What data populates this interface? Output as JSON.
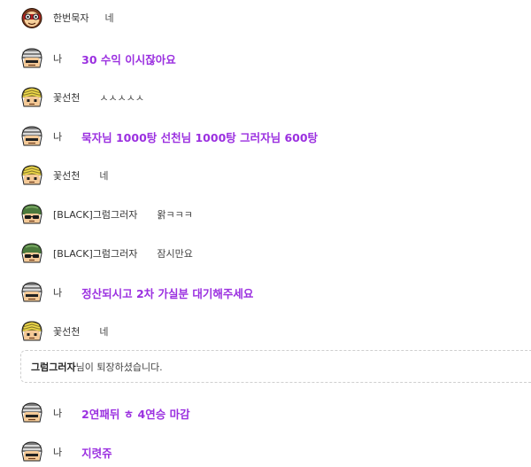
{
  "colors": {
    "my_message": "#9b30e0",
    "other_message": "#444444",
    "name_text": "#333333",
    "notice_border": "#cfcfcf"
  },
  "messages": [
    {
      "avatar": "red-goggles-avatar-icon",
      "name": "한번묵자",
      "text": "네",
      "mine": false
    },
    {
      "avatar": "gray-helmet-avatar-icon",
      "name": "나",
      "text": "30 수익 이시잖아요",
      "mine": true
    },
    {
      "avatar": "yellow-chevron-cap-avatar-icon",
      "name": "꽃선천",
      "text": "ㅅㅅㅅㅅㅅ",
      "mine": false
    },
    {
      "avatar": "gray-helmet-avatar-icon",
      "name": "나",
      "text": "묵자님 1000탕 선천님 1000탕 그러자님 600탕",
      "mine": true
    },
    {
      "avatar": "yellow-chevron-cap-avatar-icon",
      "name": "꽃선천",
      "text": "네",
      "mine": false
    },
    {
      "avatar": "green-helmet-sunglasses-avatar-icon",
      "name": "[BLACK]그럼그러자",
      "text": "왉ㅋㅋㅋ",
      "mine": false
    },
    {
      "avatar": "green-helmet-sunglasses-avatar-icon",
      "name": "[BLACK]그럼그러자",
      "text": "잠시만요",
      "mine": false
    },
    {
      "avatar": "gray-helmet-avatar-icon",
      "name": "나",
      "text": "정산되시고 2차 가실분 대기해주세요",
      "mine": true
    },
    {
      "avatar": "yellow-chevron-cap-avatar-icon",
      "name": "꽃선천",
      "text": "네",
      "mine": false
    },
    {
      "avatar": "gray-helmet-avatar-icon",
      "name": "나",
      "text": "2연패뒤 ㅎ 4연승 마감",
      "mine": true
    },
    {
      "avatar": "gray-helmet-avatar-icon",
      "name": "나",
      "text": "지렷쥬",
      "mine": true
    }
  ],
  "notice": {
    "user": "그럼그러자",
    "text": "님이 퇴장하셨습니다."
  }
}
